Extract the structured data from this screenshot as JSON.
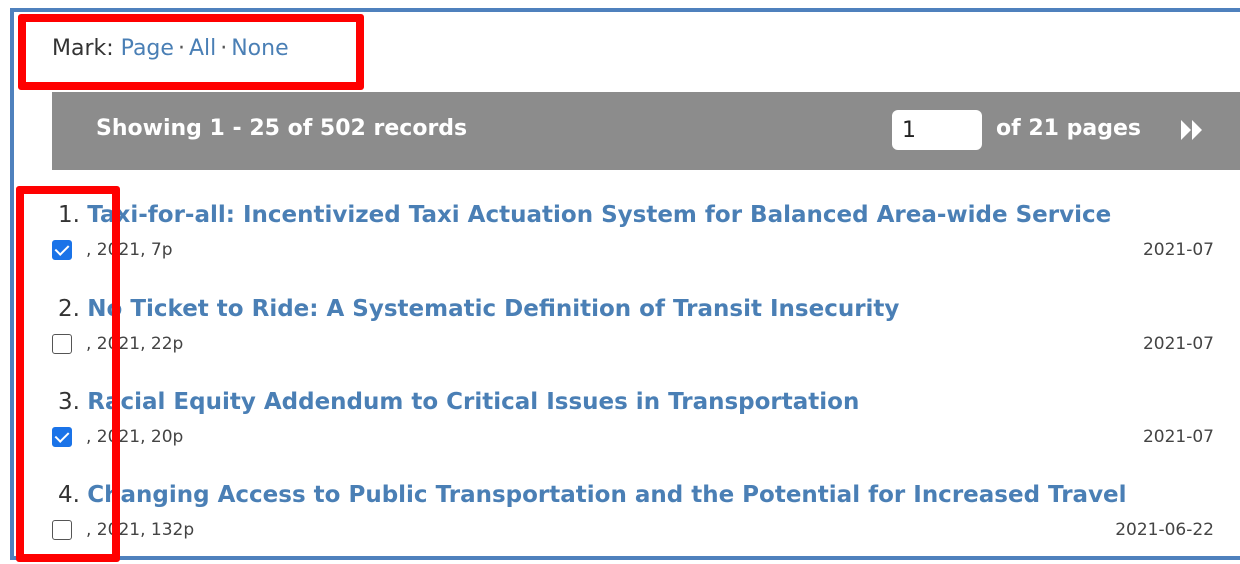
{
  "mark": {
    "label": "Mark:",
    "page": "Page",
    "all": "All",
    "none": "None",
    "separator": "·"
  },
  "pager": {
    "showing": "Showing 1 - 25 of 502 records",
    "page_value": "1",
    "of_pages": "of 21 pages",
    "next_icon": "fast-forward-icon"
  },
  "records": [
    {
      "num": "1.",
      "title": "Taxi-for-all: Incentivized Taxi Actuation System for Balanced Area-wide Service",
      "meta": ", 2021, 7p",
      "date": "2021-07",
      "checked": true
    },
    {
      "num": "2.",
      "title": "No Ticket to Ride: A Systematic Definition of Transit Insecurity",
      "meta": ", 2021, 22p",
      "date": "2021-07",
      "checked": false
    },
    {
      "num": "3.",
      "title": "Racial Equity Addendum to Critical Issues in Transportation",
      "meta": ", 2021, 20p",
      "date": "2021-07",
      "checked": true
    },
    {
      "num": "4.",
      "title": "Changing Access to Public Transportation and the Potential for Increased Travel",
      "meta": ", 2021, 132p",
      "date": "2021-06-22",
      "checked": false
    }
  ],
  "colors": {
    "border_blue": "#4f81bd",
    "link_blue": "#4a7fb5",
    "pager_gray": "#8c8c8c",
    "highlight_red": "#ff0000",
    "checkbox_blue": "#1a73e8"
  }
}
